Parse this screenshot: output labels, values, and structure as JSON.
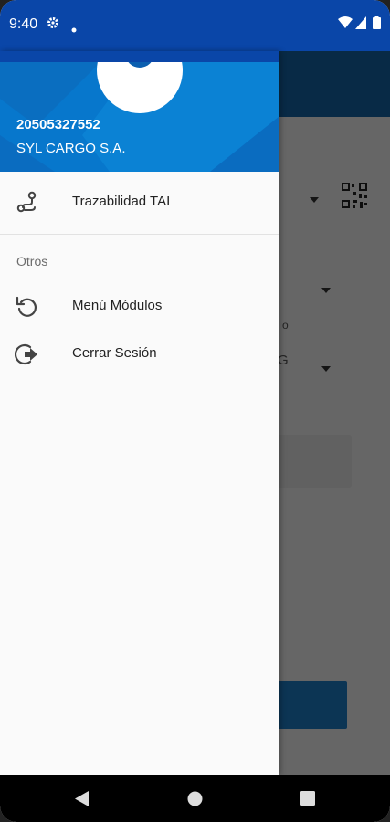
{
  "status_bar": {
    "time": "9:40",
    "icons": [
      "settings-icon",
      "notification-dot-icon",
      "wifi-icon",
      "signal-icon",
      "battery-icon"
    ]
  },
  "drawer": {
    "header": {
      "ruc": "20505327552",
      "company": "SYL CARGO S.A."
    },
    "items": [
      {
        "label": "Trazabilidad TAI",
        "icon": "route-icon"
      }
    ],
    "section_title": "Otros",
    "other_items": [
      {
        "label": "Menú Módulos",
        "icon": "undo-icon"
      },
      {
        "label": "Cerrar Sesión",
        "icon": "logout-icon"
      }
    ]
  },
  "background": {
    "partial_text": "o",
    "partial_value": "G"
  },
  "colors": {
    "status_bar": "#0a46a8",
    "drawer_header": "#0777cc",
    "scrim": "rgba(0,0,0,0.58)"
  }
}
